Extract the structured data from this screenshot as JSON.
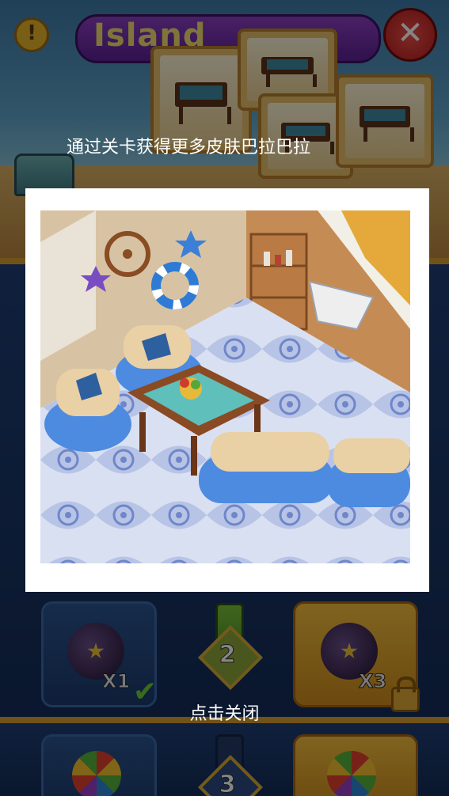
{
  "header": {
    "title_text": "Island",
    "alert_label": "!",
    "close_label": "✕"
  },
  "levels": [
    {
      "number": "2",
      "left_reward": "X1",
      "right_reward": "X3"
    },
    {
      "number": "3"
    }
  ],
  "popup": {
    "hint": "通过关卡获得更多皮肤巴拉巴拉",
    "close_hint": "点击关闭"
  },
  "icons": {
    "alert": "exclamation-icon",
    "close": "close-x-icon",
    "completed": "checkmark-icon",
    "locked": "lock-icon",
    "reward_bomb": "bomb-booster-icon",
    "reward_disco": "disco-ball-booster-icon",
    "furniture": "coffee-table-icon"
  },
  "colors": {
    "overlay": "#000000",
    "title_ribbon": "#7a34b0",
    "gold_slot": "#e9a82c",
    "close_button": "#d93333",
    "floor_tile": "#c7d2ea",
    "sofa_blue": "#4f8fe0"
  }
}
